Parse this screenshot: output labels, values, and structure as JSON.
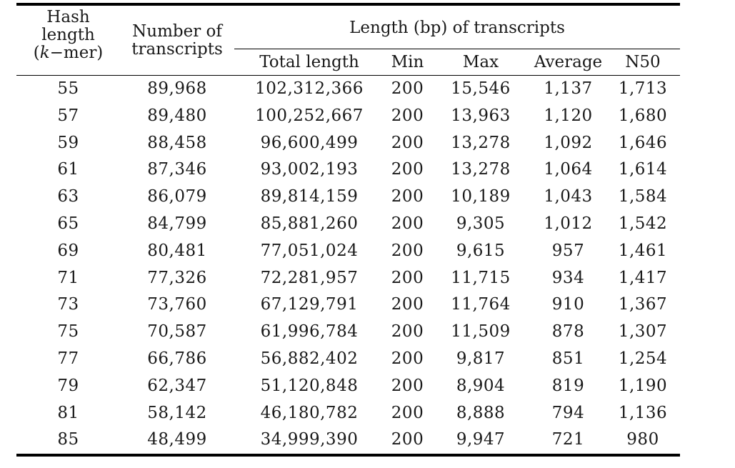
{
  "table": {
    "header": {
      "hash_length_line1": "Hash",
      "hash_length_line2": "length",
      "hash_length_line3_open": "(",
      "hash_length_line3_k": "k",
      "hash_length_line3_rest": "−mer)",
      "num_transcripts_line1": "Number of",
      "num_transcripts_line2": "transcripts",
      "group_label": "Length (bp) of transcripts",
      "sub_columns": [
        "Total length",
        "Min",
        "Max",
        "Average",
        "N50"
      ]
    },
    "rows": [
      {
        "kmer": "55",
        "number": "89,968",
        "total": "102,312,366",
        "min": "200",
        "max": "15,546",
        "average": "1,137",
        "n50": "1,713"
      },
      {
        "kmer": "57",
        "number": "89,480",
        "total": "100,252,667",
        "min": "200",
        "max": "13,963",
        "average": "1,120",
        "n50": "1,680"
      },
      {
        "kmer": "59",
        "number": "88,458",
        "total": "96,600,499",
        "min": "200",
        "max": "13,278",
        "average": "1,092",
        "n50": "1,646"
      },
      {
        "kmer": "61",
        "number": "87,346",
        "total": "93,002,193",
        "min": "200",
        "max": "13,278",
        "average": "1,064",
        "n50": "1,614"
      },
      {
        "kmer": "63",
        "number": "86,079",
        "total": "89,814,159",
        "min": "200",
        "max": "10,189",
        "average": "1,043",
        "n50": "1,584"
      },
      {
        "kmer": "65",
        "number": "84,799",
        "total": "85,881,260",
        "min": "200",
        "max": "9,305",
        "average": "1,012",
        "n50": "1,542"
      },
      {
        "kmer": "69",
        "number": "80,481",
        "total": "77,051,024",
        "min": "200",
        "max": "9,615",
        "average": "957",
        "n50": "1,461"
      },
      {
        "kmer": "71",
        "number": "77,326",
        "total": "72,281,957",
        "min": "200",
        "max": "11,715",
        "average": "934",
        "n50": "1,417"
      },
      {
        "kmer": "73",
        "number": "73,760",
        "total": "67,129,791",
        "min": "200",
        "max": "11,764",
        "average": "910",
        "n50": "1,367"
      },
      {
        "kmer": "75",
        "number": "70,587",
        "total": "61,996,784",
        "min": "200",
        "max": "11,509",
        "average": "878",
        "n50": "1,307"
      },
      {
        "kmer": "77",
        "number": "66,786",
        "total": "56,882,402",
        "min": "200",
        "max": "9,817",
        "average": "851",
        "n50": "1,254"
      },
      {
        "kmer": "79",
        "number": "62,347",
        "total": "51,120,848",
        "min": "200",
        "max": "8,904",
        "average": "819",
        "n50": "1,190"
      },
      {
        "kmer": "81",
        "number": "58,142",
        "total": "46,180,782",
        "min": "200",
        "max": "8,888",
        "average": "794",
        "n50": "1,136"
      },
      {
        "kmer": "85",
        "number": "48,499",
        "total": "34,999,390",
        "min": "200",
        "max": "9,947",
        "average": "721",
        "n50": "980"
      }
    ]
  }
}
